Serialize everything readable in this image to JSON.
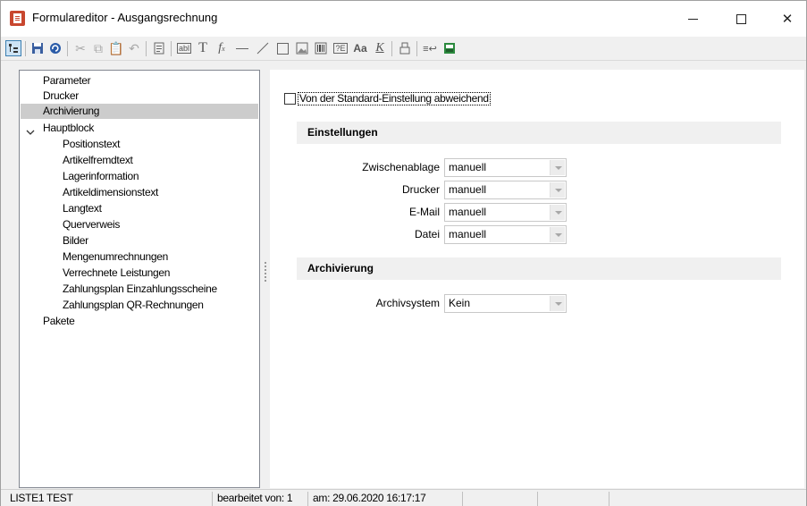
{
  "window": {
    "title": "Formulareditor - Ausgangsrechnung",
    "minimize_icon": "minimize-icon",
    "maximize_icon": "maximize-icon",
    "close_glyph": "✕"
  },
  "toolbar": {
    "icons": [
      "tree-view-icon",
      "save-icon",
      "refresh-icon",
      "cut-icon",
      "copy-icon",
      "paste-icon",
      "undo-icon",
      "properties-icon",
      "text-field-icon",
      "text-icon",
      "formula-icon",
      "horizontal-line-icon",
      "diagonal-line-icon",
      "rectangle-icon",
      "image-icon",
      "barcode-icon",
      "variable-icon",
      "font-icon",
      "clear-format-icon",
      "layers-icon",
      "insert-icon",
      "print-preview-icon"
    ]
  },
  "tree": {
    "items": [
      {
        "label": "Parameter",
        "level": 0
      },
      {
        "label": "Drucker",
        "level": 0
      },
      {
        "label": "Archivierung",
        "level": 0,
        "selected": true
      },
      {
        "label": "Hauptblock",
        "level": 0,
        "expanded": true
      },
      {
        "label": "Positionstext",
        "level": 1
      },
      {
        "label": "Artikelfremdtext",
        "level": 1
      },
      {
        "label": "Lagerinformation",
        "level": 1
      },
      {
        "label": "Artikeldimensionstext",
        "level": 1
      },
      {
        "label": "Langtext",
        "level": 1
      },
      {
        "label": "Querverweis",
        "level": 1
      },
      {
        "label": "Bilder",
        "level": 1
      },
      {
        "label": "Mengenumrechnungen",
        "level": 1
      },
      {
        "label": "Verrechnete Leistungen",
        "level": 1
      },
      {
        "label": "Zahlungsplan Einzahlungsscheine",
        "level": 1
      },
      {
        "label": "Zahlungsplan QR-Rechnungen",
        "level": 1
      },
      {
        "label": "Pakete",
        "level": 0
      }
    ]
  },
  "settings": {
    "override_checkbox_label": "Von der Standard-Einstellung abweichend",
    "override_checked": false,
    "section_einstellungen": "Einstellungen",
    "fields": [
      {
        "label": "Zwischenablage",
        "value": "manuell"
      },
      {
        "label": "Drucker",
        "value": "manuell"
      },
      {
        "label": "E-Mail",
        "value": "manuell"
      },
      {
        "label": "Datei",
        "value": "manuell"
      }
    ],
    "section_archivierung": "Archivierung",
    "archiv": {
      "label": "Archivsystem",
      "value": "Kein"
    }
  },
  "statusbar": {
    "list": "LISTE1 TEST",
    "edited_by": "bearbeitet von:  1",
    "edited_at": "am: 29.06.2020 16:17:17"
  }
}
